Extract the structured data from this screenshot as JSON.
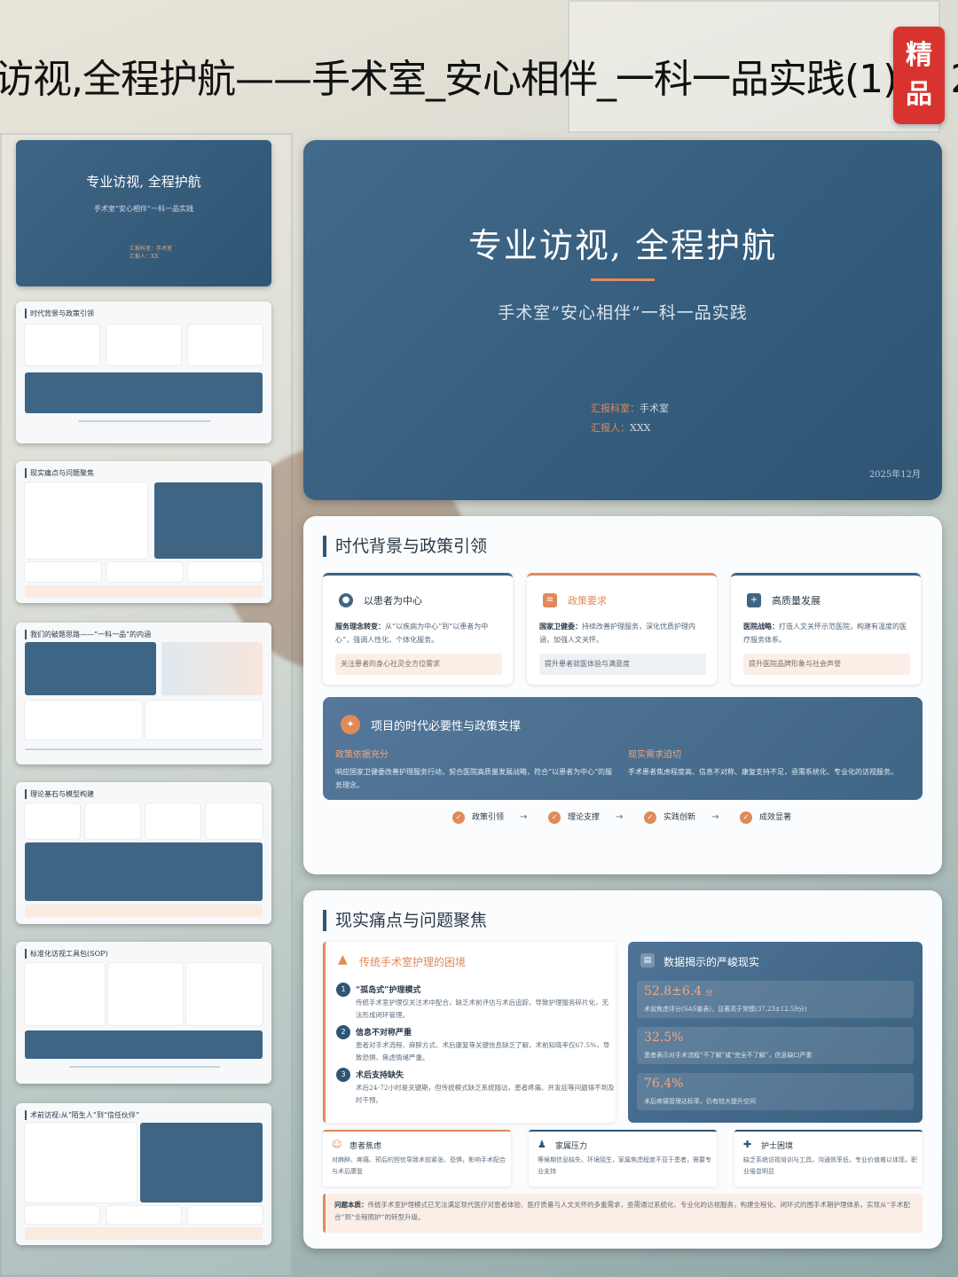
{
  "header": {
    "title_strip": "访视,全程护航——手术室_安心相伴_一科一品实践(1)",
    "title_strip_tail": "2",
    "badge_line1": "精",
    "badge_line2": "品"
  },
  "thumbs": {
    "cover_title": "专业访视, 全程护航",
    "cover_sub": "手术室“安心相伴”一科一品实践",
    "cover_meta1": "汇报科室：手术室",
    "cover_meta2": "汇报人：XX",
    "t2": "时代背景与政策引领",
    "t3": "现实痛点与问题聚焦",
    "t4": "我们的破题思路——“一科一品”的内涵",
    "t5": "理论基石与模型构建",
    "t6": "标准化访视工具包(SOP)",
    "t7": "术前访视:从“陌生人”到“信任伙伴”"
  },
  "slide1": {
    "title": "专业访视, 全程护航",
    "subtitle": "手术室”安心相伴”一科一品实践",
    "dept_label": "汇报科室：",
    "dept_value": "手术室",
    "reporter_label": "汇报人：",
    "reporter_value": "XXX",
    "date": "2025年12月"
  },
  "slide2": {
    "heading": "时代背景与政策引领",
    "cards": [
      {
        "icon": "user-icon",
        "title": "以患者为中心",
        "lead": "服务理念转变：",
        "text": "从“以疾病为中心”到“以患者为中心”，强调人性化、个体化服务。",
        "tag": "关注患者的身心社灵全方位需求"
      },
      {
        "icon": "document-icon",
        "title": "政策要求",
        "lead": "国家卫健委：",
        "text": "持续改善护理服务，深化优质护理内涵，加强人文关怀。",
        "tag": "提升患者就医体验与满意度"
      },
      {
        "icon": "hospital-icon",
        "title": "高质量发展",
        "lead": "医院战略：",
        "text": "打造人文关怀示范医院，构建有温度的医疗服务体系。",
        "tag": "提升医院品牌形象与社会声誉"
      }
    ],
    "band": {
      "title": "项目的时代必要性与政策支撑",
      "left_key": "政策依据充分",
      "left_text": "响应国家卫健委改善护理服务行动，契合医院高质量发展战略，符合“以患者为中心”的服务理念。",
      "right_key": "现实需求迫切",
      "right_text": "手术患者焦虑程度高、信息不对称、康复支持不足，亟需系统化、专业化的访视服务。"
    },
    "flow": [
      "政策引领",
      "理论支撑",
      "实践创新",
      "成效显著"
    ]
  },
  "slide3": {
    "heading": "现实痛点与问题聚焦",
    "pain_title": "传统手术室护理的困境",
    "pains": [
      {
        "num": "1",
        "title": "“孤岛式”护理模式",
        "text": "传统手术室护理仅关注术中配合，缺乏术前评估与术后追踪，导致护理服务碎片化，无法形成闭环管理。"
      },
      {
        "num": "2",
        "title": "信息不对称严重",
        "text": "患者对手术流程、麻醉方式、术后康复等关键信息缺乏了解，术前知晓率仅67.5%，导致恐惧、焦虑情绪严重。"
      },
      {
        "num": "3",
        "title": "术后支持缺失",
        "text": "术后24-72小时是关键期，但传统模式缺乏系统随访，患者疼痛、并发症等问题得不到及时干预。"
      }
    ],
    "data_title": "数据揭示的严峻现实",
    "stats": [
      {
        "value": "52.8±6.4",
        "unit": "分",
        "text": "术前焦虑评分(SAS量表)，显著高于常模(37.23±12.59分)"
      },
      {
        "value": "32.5%",
        "unit": "",
        "text": "患者表示对手术流程“不了解”或“完全不了解”，信息缺口严重"
      },
      {
        "value": "76.4%",
        "unit": "",
        "text": "术后疼痛管理达标率，仍有较大提升空间"
      }
    ],
    "minis": [
      {
        "icon": "anxious-person-icon",
        "title": "患者焦虑",
        "text": "对麻醉、疼痛、预后的担忧导致术前紧张、恐惧，影响手术配合与术后康复"
      },
      {
        "icon": "family-icon",
        "title": "家属压力",
        "text": "等候期信息缺失、环境陌生，家属焦虑程度不亚于患者，需要专业支持"
      },
      {
        "icon": "nurse-icon",
        "title": "护士困境",
        "text": "缺乏系统访视培训与工具，沟通效率低，专业价值难以体现，职业倦怠明显"
      }
    ],
    "root_lead": "问题本质：",
    "root_text": "传统手术室护理模式已无法满足现代医疗对患者体验、医疗质量与人文关怀的多重需求，亟需通过系统化、专业化的访视服务，构建全程化、闭环式的围手术期护理体系，实现从“手术配合”到“全程照护”的转型升级。"
  }
}
